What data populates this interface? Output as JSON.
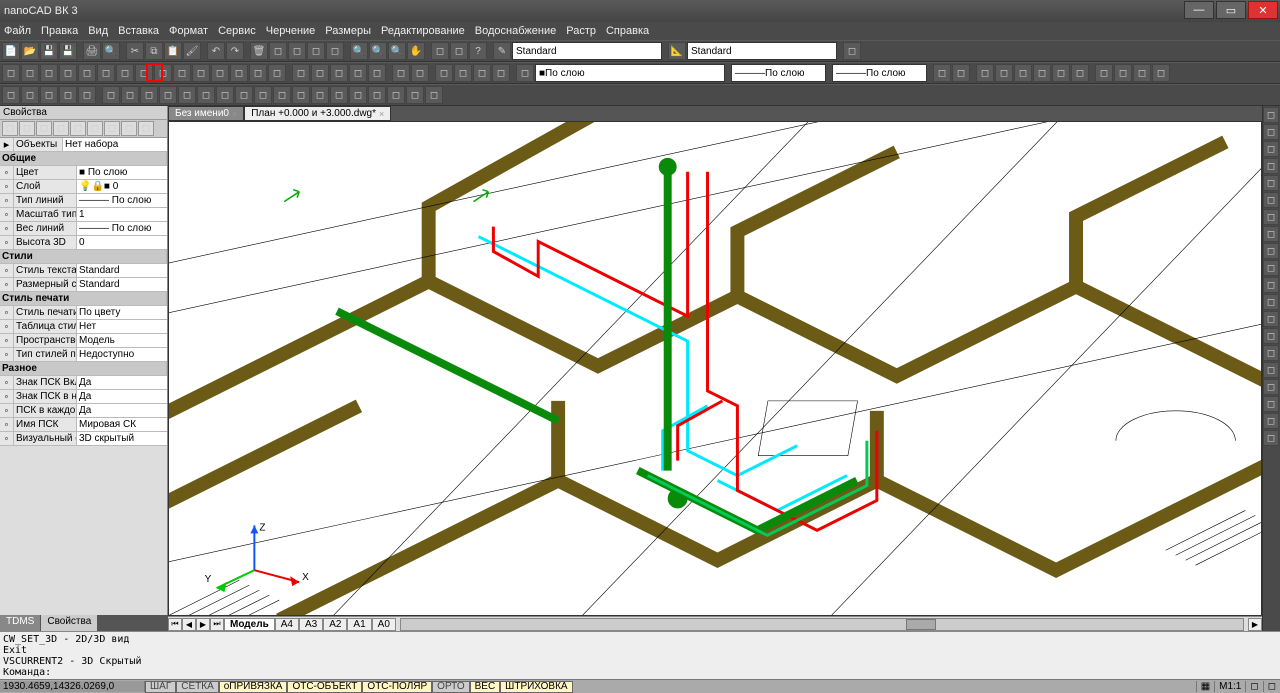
{
  "title": "nanoCAD ВК 3",
  "menu": [
    "Файл",
    "Правка",
    "Вид",
    "Вставка",
    "Формат",
    "Сервис",
    "Черчение",
    "Размеры",
    "Редактирование",
    "Водоснабжение",
    "Растр",
    "Справка"
  ],
  "toolbar2": {
    "style1": "Standard",
    "style2": "Standard"
  },
  "toolbar3": {
    "layer_color": "По слою",
    "linetype": "По слою",
    "lineweight": "По слою"
  },
  "tabs": [
    {
      "label": "Без имени0",
      "active": false
    },
    {
      "label": "План +0.000 и +3.000.dwg*",
      "active": true
    }
  ],
  "properties": {
    "panel_title": "Свойства",
    "objects_label": "Объекты",
    "objects_value": "Нет набора",
    "groups": [
      {
        "title": "Общие",
        "rows": [
          {
            "label": "Цвет",
            "value": "■ По слою"
          },
          {
            "label": "Слой",
            "value": "💡🔒■ 0"
          },
          {
            "label": "Тип линий",
            "value": "——— По слою"
          },
          {
            "label": "Масштаб типа ...",
            "value": "1"
          },
          {
            "label": "Вес линий",
            "value": "——— По слою"
          },
          {
            "label": "Высота 3D",
            "value": "0"
          }
        ]
      },
      {
        "title": "Стили",
        "rows": [
          {
            "label": "Стиль текста",
            "value": "Standard"
          },
          {
            "label": "Размерный ст...",
            "value": "Standard"
          }
        ]
      },
      {
        "title": "Стиль печати",
        "rows": [
          {
            "label": "Стиль печати",
            "value": "По цвету"
          },
          {
            "label": "Таблица стиле...",
            "value": "Нет"
          },
          {
            "label": "Пространство ...",
            "value": "Модель"
          },
          {
            "label": "Тип стилей печ...",
            "value": "Недоступно"
          }
        ]
      },
      {
        "title": "Разное",
        "rows": [
          {
            "label": "Знак ПСК Вкл",
            "value": "Да"
          },
          {
            "label": "Знак ПСК в на...",
            "value": "Да"
          },
          {
            "label": "ПСК в каждом ...",
            "value": "Да"
          },
          {
            "label": "Имя ПСК",
            "value": "Мировая СК"
          },
          {
            "label": "Визуальный ст...",
            "value": "3D скрытый"
          }
        ]
      }
    ],
    "tabs": [
      "TDMS",
      "Свойства"
    ]
  },
  "bottom_tabs": [
    "Модель",
    "A4",
    "A3",
    "A2",
    "A1",
    "A0"
  ],
  "cmdlines": [
    "CW_SET_3D - 2D/3D вид",
    "Exit",
    "VSCURRENT2 - 3D Скрытый",
    "Команда:"
  ],
  "status": {
    "coords": "1930.4659,14326.0269,0",
    "toggles": [
      {
        "label": "ШАГ",
        "on": false
      },
      {
        "label": "СЕТКА",
        "on": false
      },
      {
        "label": "оПРИВЯЗКА",
        "on": true
      },
      {
        "label": "ОТС-ОБЪЕКТ",
        "on": true
      },
      {
        "label": "ОТС-ПОЛЯР",
        "on": true
      },
      {
        "label": "ОРТО",
        "on": false
      },
      {
        "label": "ВЕС",
        "on": true
      },
      {
        "label": "ШТРИХОВКА",
        "on": true
      }
    ],
    "scale": "M1:1"
  },
  "ucs": {
    "x": "X",
    "y": "Y",
    "z": "Z"
  }
}
